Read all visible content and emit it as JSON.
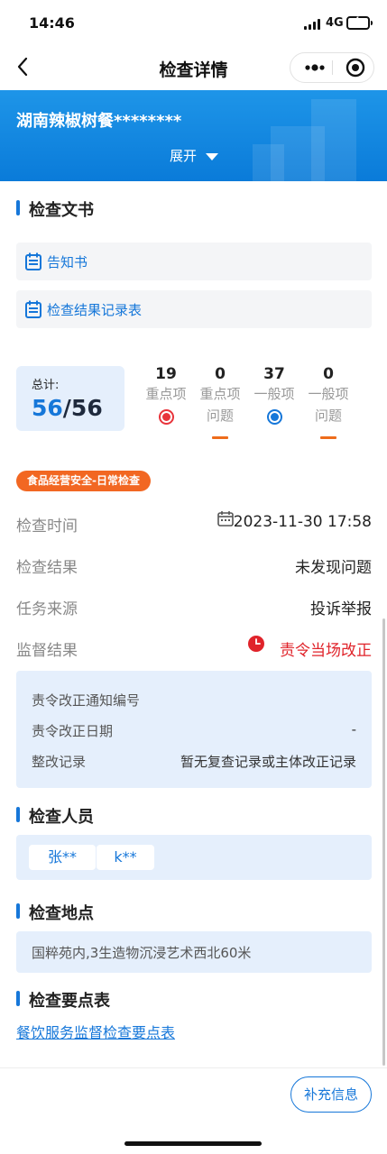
{
  "status_bar": {
    "time": "14:46",
    "network": "4G"
  },
  "nav": {
    "title": "检查详情"
  },
  "header": {
    "store_name": "湖南辣椒树餐********",
    "expand_label": "展开"
  },
  "documents": {
    "section_title": "检查文书",
    "items": [
      {
        "label": "告知书",
        "icon": "document-icon"
      },
      {
        "label": "检查结果记录表",
        "icon": "document-icon"
      }
    ]
  },
  "stats": {
    "total_label": "总计:",
    "total_done": "56",
    "total_all": "/56",
    "items": [
      {
        "value": "19",
        "label_line1": "重点项",
        "label_line2": "",
        "marker": "red-dot"
      },
      {
        "value": "0",
        "label_line1": "重点项",
        "label_line2": "问题",
        "marker": "orange-dash"
      },
      {
        "value": "37",
        "label_line1": "一般项",
        "label_line2": "",
        "marker": "blue-dot"
      },
      {
        "value": "0",
        "label_line1": "一般项",
        "label_line2": "问题",
        "marker": "orange-dash"
      }
    ]
  },
  "tag": "食品经营安全-日常检查",
  "info": {
    "inspect_time_label": "检查时间",
    "inspect_time_value": "2023-11-30 17:58",
    "inspect_result_label": "检查结果",
    "inspect_result_value": "未发现问题",
    "task_source_label": "任务来源",
    "task_source_value": "投诉举报",
    "supervision_label": "监督结果",
    "supervision_value": "责令当场改正"
  },
  "rectify": {
    "notice_no_label": "责令改正通知编号",
    "notice_no_value": "",
    "date_label": "责令改正日期",
    "date_value": "-",
    "record_label": "整改记录",
    "record_value": "暂无复查记录或主体改正记录"
  },
  "inspectors": {
    "section_title": "检查人员",
    "names": [
      "张**",
      "k**"
    ]
  },
  "location": {
    "section_title": "检查地点",
    "address": "国粹苑内,3生造物沉浸艺术西北60米"
  },
  "checklist": {
    "section_title": "检查要点表",
    "link_label": "餐饮服务监督检查要点表"
  },
  "bottom": {
    "supplement_button": "补充信息"
  },
  "colors": {
    "primary": "#1677d9",
    "banner": "#0a7bd9",
    "accent_orange": "#f26722",
    "alert_red": "#e0232a",
    "light_blue_bg": "#e5effc"
  }
}
